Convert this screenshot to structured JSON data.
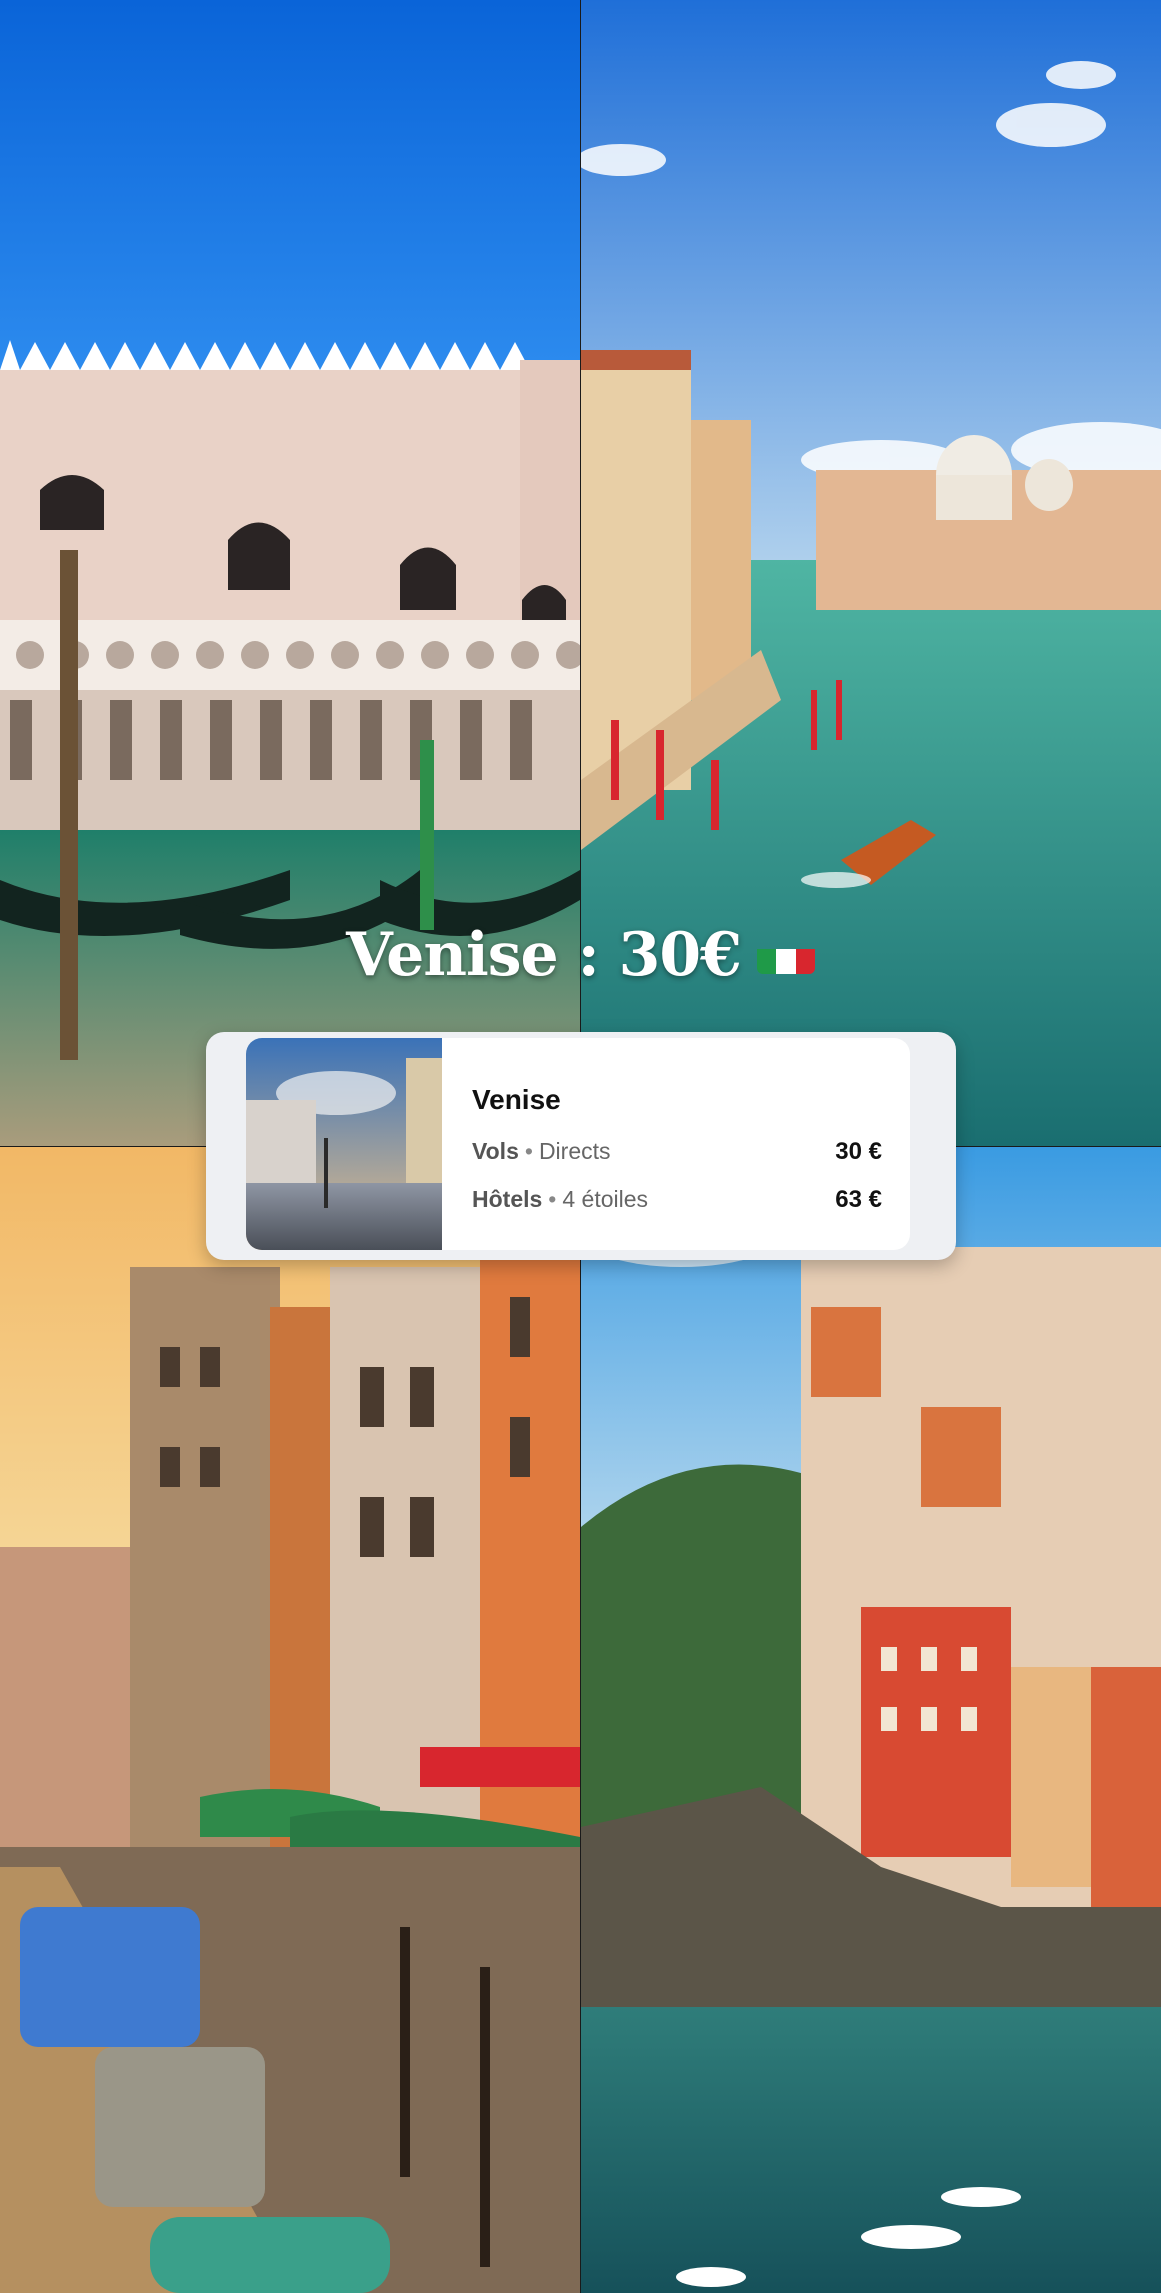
{
  "headline": {
    "text": "Venise : 30€"
  },
  "flag": {
    "colors": [
      "#1f9a48",
      "#ffffff",
      "#d8262e"
    ]
  },
  "card": {
    "title": "Venise",
    "rows": [
      {
        "label": "Vols",
        "detail": "Directs",
        "price": "30 €"
      },
      {
        "label": "Hôtels",
        "detail": "4 étoiles",
        "price": "63 €"
      }
    ]
  }
}
